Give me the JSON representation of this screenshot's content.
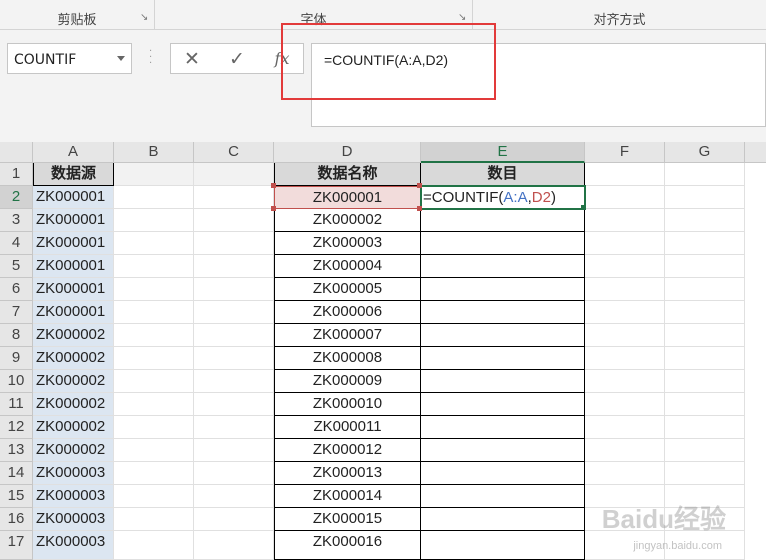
{
  "ribbon": {
    "groups": [
      "剪贴板",
      "字体",
      "对齐方式"
    ]
  },
  "name_box": {
    "value": "COUNTIF"
  },
  "formula_bar": {
    "cancel_symbol": "✕",
    "enter_symbol": "✓",
    "fx_symbol": "fx",
    "formula": "=COUNTIF(A:A,D2)"
  },
  "columns": [
    "A",
    "B",
    "C",
    "D",
    "E",
    "F",
    "G"
  ],
  "rows": [
    "1",
    "2",
    "3",
    "4",
    "5",
    "6",
    "7",
    "8",
    "9",
    "10",
    "11",
    "12",
    "13",
    "14",
    "15",
    "16",
    "17"
  ],
  "header_row": {
    "A": "数据源",
    "D": "数据名称",
    "E": "数目"
  },
  "columnA": [
    "ZK000001",
    "ZK000001",
    "ZK000001",
    "ZK000001",
    "ZK000001",
    "ZK000001",
    "ZK000002",
    "ZK000002",
    "ZK000002",
    "ZK000002",
    "ZK000002",
    "ZK000002",
    "ZK000003",
    "ZK000003",
    "ZK000003",
    "ZK000003"
  ],
  "columnD": [
    "ZK000001",
    "ZK000002",
    "ZK000003",
    "ZK000004",
    "ZK000005",
    "ZK000006",
    "ZK000007",
    "ZK000008",
    "ZK000009",
    "ZK000010",
    "ZK000011",
    "ZK000012",
    "ZK000013",
    "ZK000014",
    "ZK000015",
    "ZK000016"
  ],
  "active_cell": {
    "prefix": "=COUNTIF(",
    "ref1": "A:A",
    "comma": ",",
    "ref2": "D2",
    "suffix": ")"
  },
  "watermark": {
    "logo": "Baidu经验",
    "url": "jingyan.baidu.com"
  },
  "colors": {
    "accent": "#217346",
    "ref_blue": "#4472c4",
    "ref_red": "#c0504d",
    "highlight_box": "#e23a3a"
  }
}
